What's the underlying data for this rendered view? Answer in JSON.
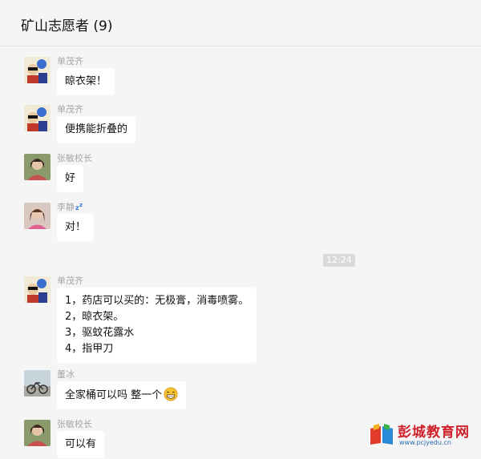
{
  "header": {
    "title": "矿山志愿者 (9)"
  },
  "timestamp": "12:24",
  "messages": [
    {
      "sender": "单茂齐",
      "lines": [
        "晾衣架！"
      ]
    },
    {
      "sender": "单茂齐",
      "lines": [
        "便携能折叠的"
      ]
    },
    {
      "sender": "张敏校长",
      "lines": [
        "好"
      ]
    },
    {
      "sender": "李静",
      "lines": [
        "对！"
      ]
    },
    {
      "sender": "单茂齐",
      "lines": [
        "1，药店可以买的：无极膏，消毒喷雾。",
        "2，晾衣架。",
        "3，驱蚊花露水",
        "4，指甲刀"
      ]
    },
    {
      "sender": "董冰",
      "lines": [
        "全家桶可以吗 整一个"
      ]
    },
    {
      "sender": "张敏校长",
      "lines": [
        "可以有"
      ]
    }
  ],
  "watermark": {
    "brand": "彭城教育网",
    "url": "www.pcjyedu.cn"
  },
  "colors": {
    "background": "#f5f5f5",
    "bubble": "#ffffff",
    "sender": "#a6a6a6",
    "time_bg": "#dadada",
    "brand": "#d0202a"
  },
  "icons": [
    "cartoon-avatar",
    "portrait-avatar",
    "sleep-zz-emoji",
    "grin-emoji",
    "book-logo"
  ]
}
